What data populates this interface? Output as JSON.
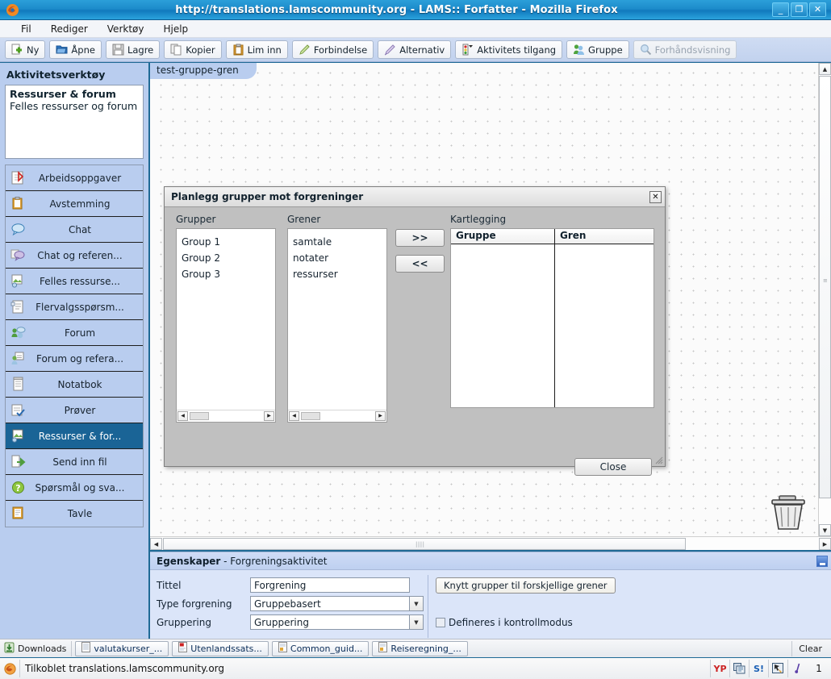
{
  "window": {
    "title": "http://translations.lamscommunity.org - LAMS:: Forfatter - Mozilla Firefox",
    "minimize_label": "_",
    "maximize_label": "❐",
    "close_label": "✕",
    "logo_icon": "firefox-icon"
  },
  "menubar": {
    "items": [
      {
        "label": "Fil"
      },
      {
        "label": "Rediger"
      },
      {
        "label": "Verktøy"
      },
      {
        "label": "Hjelp"
      }
    ]
  },
  "toolbar": {
    "buttons": [
      {
        "label": "Ny",
        "icon": "new-document-icon",
        "disabled": false
      },
      {
        "label": "Åpne",
        "icon": "open-folder-icon",
        "disabled": false
      },
      {
        "label": "Lagre",
        "icon": "save-disk-icon",
        "disabled": false
      },
      {
        "label": "Kopier",
        "icon": "copy-icon",
        "disabled": false
      },
      {
        "label": "Lim inn",
        "icon": "paste-clipboard-icon",
        "disabled": false
      },
      {
        "label": "Forbindelse",
        "icon": "pencil-line-icon",
        "disabled": false
      },
      {
        "label": "Alternativ",
        "icon": "pencil-option-icon",
        "disabled": false
      },
      {
        "label": "Aktivitets tilgang",
        "icon": "traffic-light-icon",
        "disabled": false
      },
      {
        "label": "Gruppe",
        "icon": "group-users-icon",
        "disabled": false
      },
      {
        "label": "Forhåndsvisning",
        "icon": "magnifier-icon",
        "disabled": true
      }
    ]
  },
  "sidebar": {
    "heading": "Aktivitetsverktøy",
    "description": {
      "title": "Ressurser & forum",
      "subtitle": "Felles ressurser og forum"
    },
    "items": [
      {
        "label": "Arbeidsoppgaver",
        "icon": "task-check-icon",
        "selected": false
      },
      {
        "label": "Avstemming",
        "icon": "clipboard-orange-icon",
        "selected": false
      },
      {
        "label": "Chat",
        "icon": "chat-bubble-icon",
        "selected": false
      },
      {
        "label": "Chat og referen...",
        "icon": "chat-reference-icon",
        "selected": false
      },
      {
        "label": "Felles ressurse...",
        "icon": "shared-resources-icon",
        "selected": false
      },
      {
        "label": "Flervalgsspørsm...",
        "icon": "multiple-choice-icon",
        "selected": false
      },
      {
        "label": "Forum",
        "icon": "forum-icon",
        "selected": false
      },
      {
        "label": "Forum og refera...",
        "icon": "forum-notes-icon",
        "selected": false
      },
      {
        "label": "Notatbok",
        "icon": "notebook-icon",
        "selected": false
      },
      {
        "label": "Prøver",
        "icon": "quiz-icon",
        "selected": false
      },
      {
        "label": "Ressurser & for...",
        "icon": "resources-forum-icon",
        "selected": true
      },
      {
        "label": "Send inn fil",
        "icon": "submit-file-icon",
        "selected": false
      },
      {
        "label": "Spørsmål og sva...",
        "icon": "question-answer-icon",
        "selected": false
      },
      {
        "label": "Tavle",
        "icon": "whiteboard-icon",
        "selected": false
      }
    ]
  },
  "canvas": {
    "tab_label": "test-gruppe-gren",
    "trash_icon": "trash-can-icon",
    "scroll_up_icon": "scroll-up-arrow",
    "scroll_down_icon": "scroll-down-arrow",
    "scroll_left_icon": "scroll-left-arrow",
    "scroll_right_icon": "scroll-right-arrow"
  },
  "modal": {
    "title": "Planlegg grupper mot forgreninger",
    "close_icon_label": "✕",
    "groups": {
      "label": "Grupper",
      "items": [
        "Group 1",
        "Group 2",
        "Group 3"
      ]
    },
    "branches": {
      "label": "Grener",
      "items": [
        "samtale",
        "notater",
        "ressurser"
      ]
    },
    "mapping": {
      "label": "Kartlegging",
      "columns": [
        "Gruppe",
        "Gren"
      ],
      "rows": []
    },
    "add_button": ">>",
    "remove_button": "<<",
    "close_button": "Close"
  },
  "properties": {
    "heading_bold": "Egenskaper",
    "heading_rest": " - Forgreningsaktivitet",
    "minimize_icon": "minimize-icon",
    "fields": [
      {
        "label": "Tittel",
        "type": "text",
        "value": "Forgrening"
      },
      {
        "label": "Type forgrening",
        "type": "select",
        "value": "Gruppebasert"
      },
      {
        "label": "Gruppering",
        "type": "select",
        "value": "Gruppering"
      }
    ],
    "link_button": "Knytt grupper til forskjellige  grener",
    "checkbox": {
      "label": "Defineres i kontrollmodus",
      "checked": false
    }
  },
  "downloadbar": {
    "label": "Downloads",
    "label_icon": "download-arrow-icon",
    "items": [
      {
        "label": "valutakurser_...",
        "icon": "spreadsheet-icon"
      },
      {
        "label": "Utenlandssats...",
        "icon": "pdf-icon"
      },
      {
        "label": "Common_guid...",
        "icon": "document-icon"
      },
      {
        "label": "Reiseregning_...",
        "icon": "document-icon"
      }
    ],
    "clear_label": "Clear"
  },
  "statusbar": {
    "icon": "firefox-small-icon",
    "text": "Tilkoblet translations.lamscommunity.org",
    "tray": [
      {
        "name": "yahoo-companion-icon",
        "glyph": "YP",
        "color": "#cc2222"
      },
      {
        "name": "network-icon",
        "glyph": "▣",
        "color": "#3b6ea5"
      },
      {
        "name": "skype-icon",
        "glyph": "S!",
        "color": "#1a5fb4"
      },
      {
        "name": "cursor-icon",
        "glyph": "▼",
        "color": "#2a2a2a"
      },
      {
        "name": "pen-icon",
        "glyph": "✓",
        "color": "#5b3fa8"
      }
    ],
    "count": "1"
  },
  "colors": {
    "titlebar": "#1d8ccb",
    "accent_border": "#1f6a96",
    "sidebar_bg": "#b9cdef",
    "sidebar_selected": "#1a6496",
    "modal_bg": "#c0c0c0",
    "props_bg": "#dbe5f9"
  }
}
